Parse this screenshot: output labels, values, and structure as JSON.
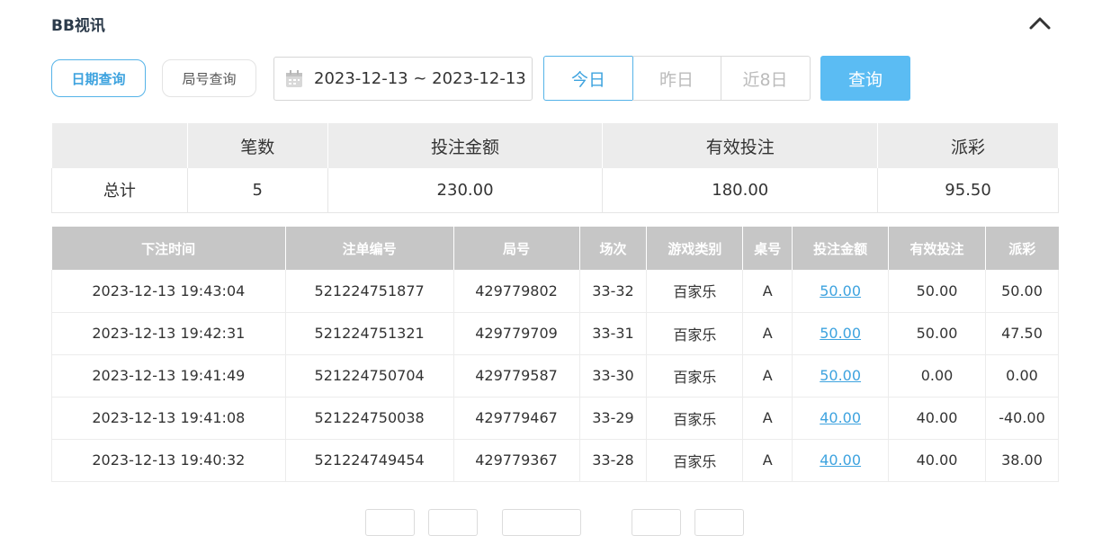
{
  "header": {
    "title": "BB视讯"
  },
  "filters": {
    "date_query_label": "日期查询",
    "round_query_label": "局号查询",
    "date_range": "2023-12-13 ~ 2023-12-13",
    "quick_ranges": [
      "今日",
      "昨日",
      "近8日"
    ],
    "active_range": "今日",
    "query_label": "查询"
  },
  "summary": {
    "headers": [
      "",
      "笔数",
      "投注金额",
      "有效投注",
      "派彩"
    ],
    "row": [
      "总计",
      "5",
      "230.00",
      "180.00",
      "95.50"
    ]
  },
  "records": {
    "headers": [
      "下注时间",
      "注单编号",
      "局号",
      "场次",
      "游戏类别",
      "桌号",
      "投注金额",
      "有效投注",
      "派彩"
    ],
    "rows": [
      [
        "2023-12-13 19:43:04",
        "521224751877",
        "429779802",
        "33-32",
        "百家乐",
        "A",
        "50.00",
        "50.00",
        "50.00"
      ],
      [
        "2023-12-13 19:42:31",
        "521224751321",
        "429779709",
        "33-31",
        "百家乐",
        "A",
        "50.00",
        "50.00",
        "47.50"
      ],
      [
        "2023-12-13 19:41:49",
        "521224750704",
        "429779587",
        "33-30",
        "百家乐",
        "A",
        "50.00",
        "0.00",
        "0.00"
      ],
      [
        "2023-12-13 19:41:08",
        "521224750038",
        "429779467",
        "33-29",
        "百家乐",
        "A",
        "40.00",
        "40.00",
        "-40.00"
      ],
      [
        "2023-12-13 19:40:32",
        "521224749454",
        "429779367",
        "33-28",
        "百家乐",
        "A",
        "40.00",
        "40.00",
        "38.00"
      ]
    ]
  },
  "colors": {
    "accent": "#5bbcf3",
    "negative": "#e53a3a",
    "header_bg": "#c6c6c6"
  },
  "icons": {
    "collapse": "chevron-up-icon",
    "calendar": "calendar-icon"
  }
}
